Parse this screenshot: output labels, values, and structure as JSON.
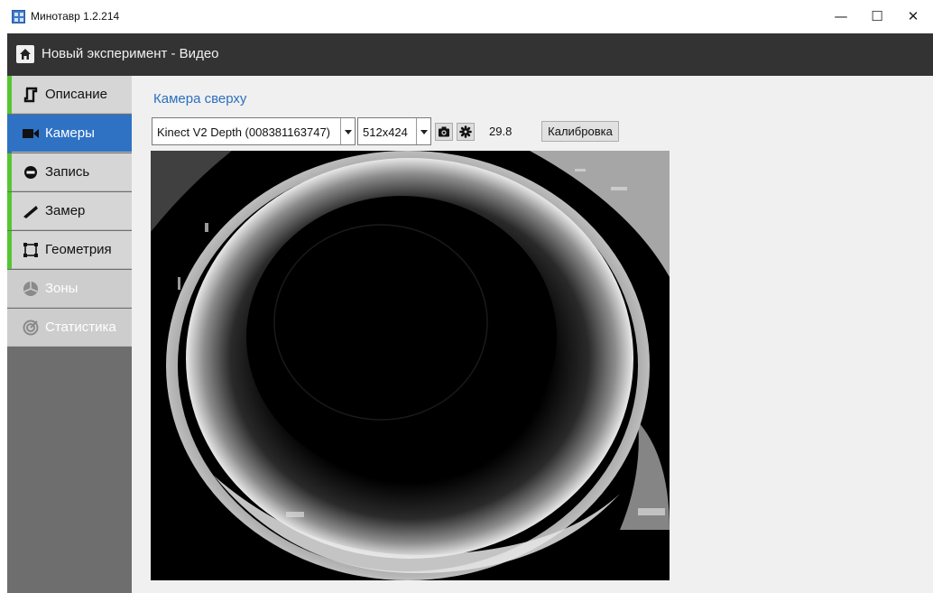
{
  "window": {
    "title": "Минотавр 1.2.214",
    "minimize": "—",
    "maximize": "☐",
    "close": "✕"
  },
  "header": {
    "title": "Новый эксперимент - Видео"
  },
  "sidebar": {
    "items": [
      {
        "label": "Описание",
        "icon": "description-icon",
        "state": "enabled"
      },
      {
        "label": "Камеры",
        "icon": "camera-icon",
        "state": "active"
      },
      {
        "label": "Запись",
        "icon": "record-icon",
        "state": "enabled"
      },
      {
        "label": "Замер",
        "icon": "ruler-icon",
        "state": "enabled"
      },
      {
        "label": "Геометрия",
        "icon": "geometry-icon",
        "state": "enabled"
      },
      {
        "label": "Зоны",
        "icon": "zones-icon",
        "state": "disabled"
      },
      {
        "label": "Статистика",
        "icon": "statistics-icon",
        "state": "disabled"
      }
    ]
  },
  "camera": {
    "title": "Камера сверху",
    "device": "Kinect V2 Depth (008381163747)",
    "resolution": "512x424",
    "fps": "29.8",
    "calibrate_label": "Калибровка"
  },
  "colors": {
    "accent_blue": "#2f72c4",
    "green_marker": "#55c534",
    "header_bg": "#333333",
    "sidebar_bg": "#6e6e6e"
  }
}
